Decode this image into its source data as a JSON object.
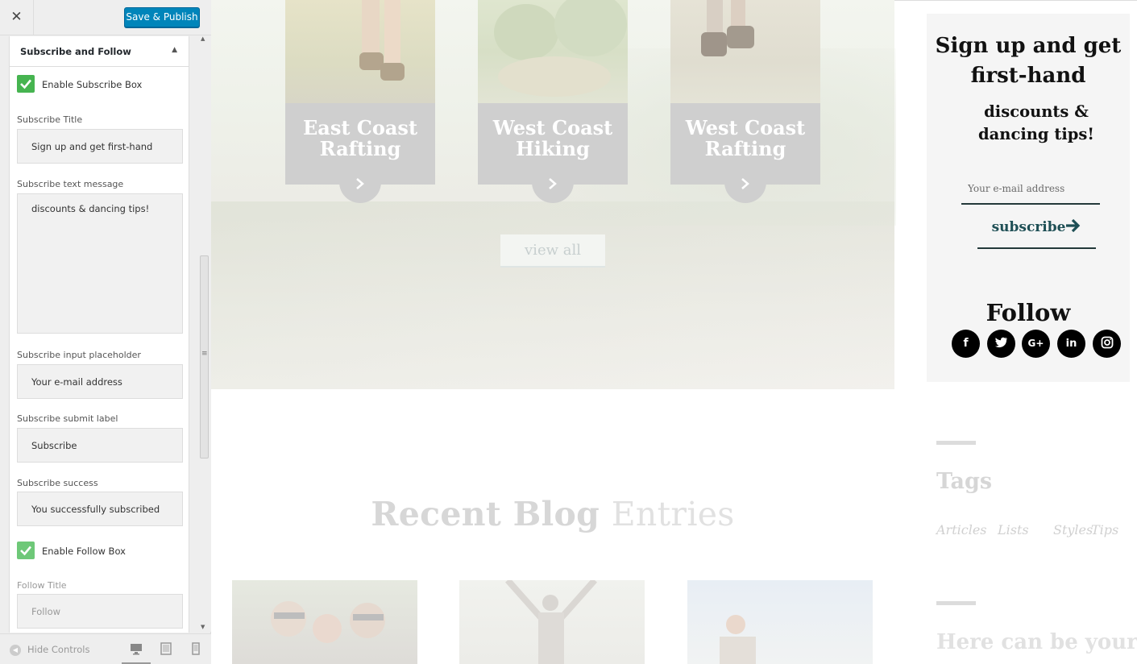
{
  "customizer": {
    "close_icon": "close-icon",
    "publish_label": "Save & Publish",
    "section_title": "Subscribe and Follow",
    "section_toggle_icon": "triangle-up-icon",
    "enable_subscribe_label": "Enable Subscribe Box",
    "subscribe_title_label": "Subscribe Title",
    "subscribe_title_value": "Sign up and get first-hand",
    "subscribe_text_label": "Subscribe text message",
    "subscribe_text_value": "discounts & dancing tips!",
    "placeholder_label": "Subscribe input placeholder",
    "placeholder_value": "Your e-mail address",
    "submit_label_label": "Subscribe submit label",
    "submit_label_value": "Subscribe",
    "success_label": "Subscribe success",
    "success_value": "You successfully subscribed",
    "enable_follow_label": "Enable Follow Box",
    "follow_title_label": "Follow Title",
    "follow_title_value": "Follow",
    "hide_controls_label": "Hide Controls",
    "accent_color": "#0085ba",
    "check_color": "#46b450"
  },
  "preview": {
    "cards": [
      {
        "title_line1": "East Coast",
        "title_line2": "Rafting"
      },
      {
        "title_line1": "West Coast",
        "title_line2": "Hiking"
      },
      {
        "title_line1": "West Coast",
        "title_line2": "Rafting"
      }
    ],
    "view_all_label": "view all",
    "blog_title_bold": "Recent Blog",
    "blog_title_light": "Entries",
    "subscribe": {
      "title": "Sign up and get first-hand",
      "text": "discounts & dancing tips!",
      "placeholder": "Your e-mail address",
      "button_label": "subscribe",
      "follow_title": "Follow",
      "socials": [
        "f",
        "t",
        "G+",
        "in",
        "ig"
      ]
    },
    "tags_title": "Tags",
    "tags": [
      "Articles",
      "Lists",
      "Styles",
      "Tips"
    ],
    "here_title": "Here can be your"
  }
}
